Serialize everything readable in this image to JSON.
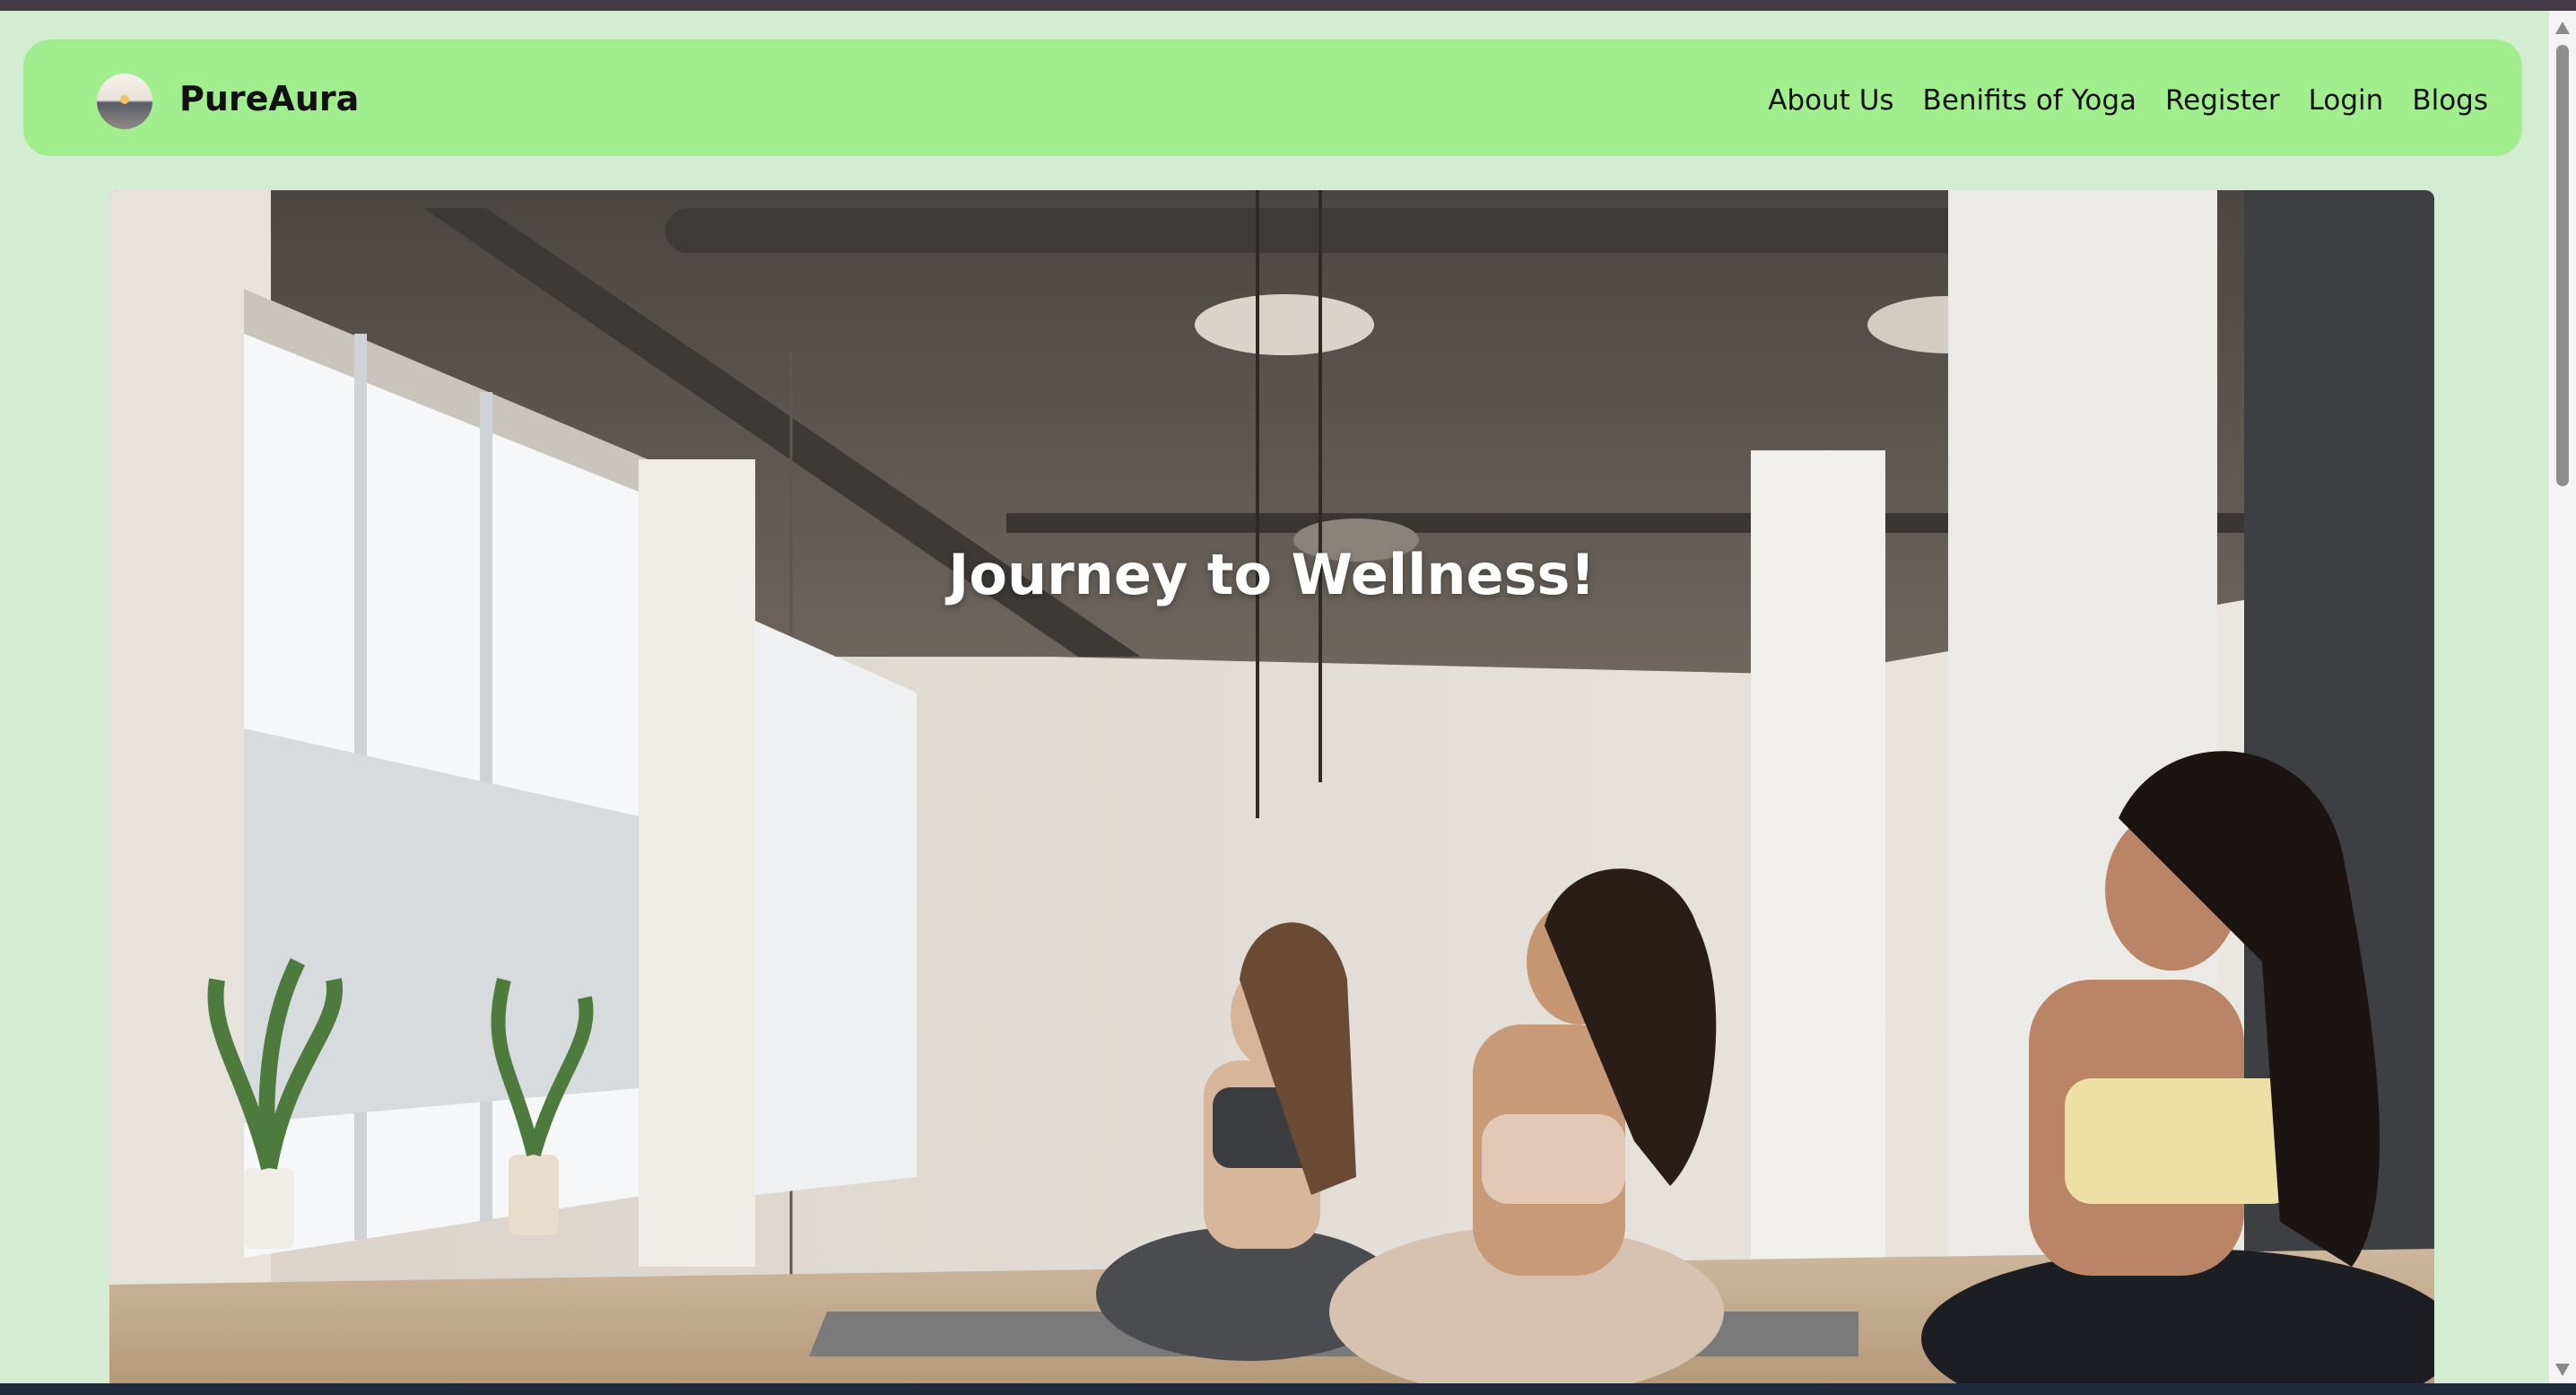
{
  "brand": {
    "name": "PureAura",
    "logo_icon": "sunset-logo-icon"
  },
  "nav": {
    "items": [
      {
        "label": "About Us"
      },
      {
        "label": "Benifits of Yoga"
      },
      {
        "label": "Register"
      },
      {
        "label": "Login"
      },
      {
        "label": "Blogs"
      }
    ]
  },
  "hero": {
    "title": "Journey to Wellness!",
    "image_icon": "yoga-class-photo"
  },
  "colors": {
    "page_background": "#d4ecd2",
    "navbar_background": "#a2ee8f",
    "text": "#111111",
    "hero_title": "#ffffff"
  }
}
